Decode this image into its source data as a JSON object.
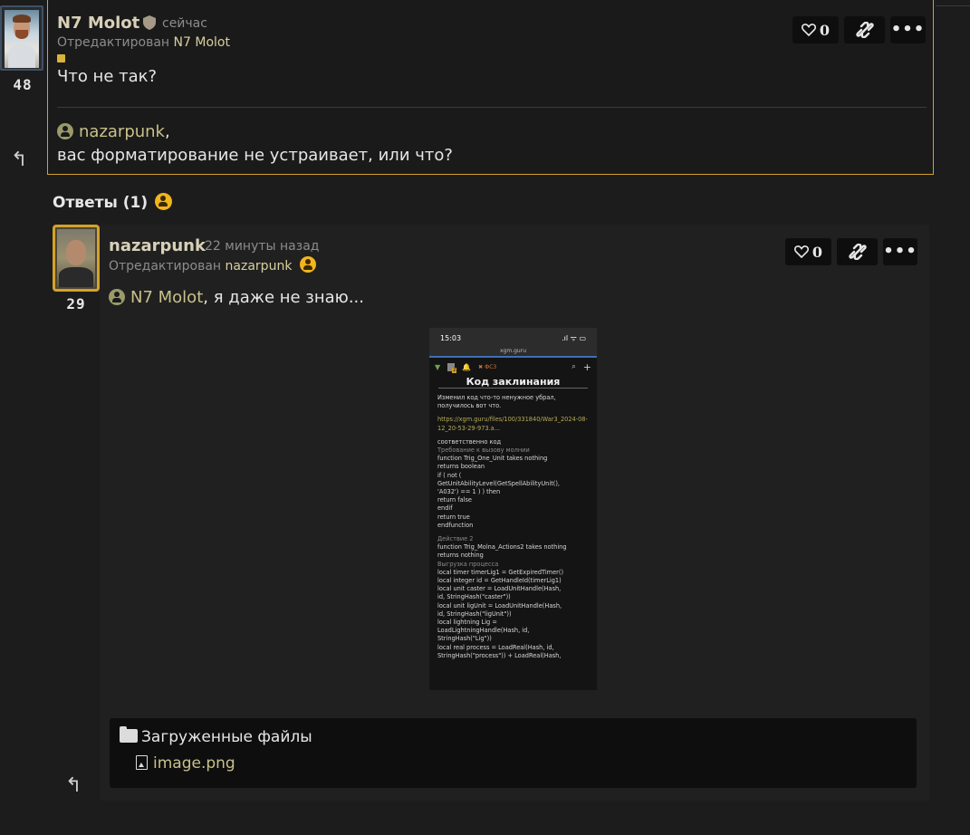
{
  "post1": {
    "author": "N7 Molot",
    "time": "сейчас",
    "edited_label": "Отредактирован",
    "edited_by": "N7 Molot",
    "score": "48",
    "text": "Что не так?",
    "quote_mention": "nazarpunk",
    "quote_suffix": ",",
    "text2": "вас форматирование не устраивает, или что?",
    "likes": "0"
  },
  "answers": {
    "label": "Ответы (1)"
  },
  "post2": {
    "author": "nazarpunk",
    "time": "22 минуты назад",
    "edited_label": "Отредактирован",
    "edited_by": "nazarpunk",
    "score": "29",
    "mention": "N7 Molot",
    "text": ", я даже не знаю...",
    "likes": "0",
    "screenshot": {
      "clock": "15:03",
      "status_icons": ".ıl ᯤ ▭",
      "url": "xgm.guru",
      "nav_label": "ФС3",
      "badge": "2",
      "title": "Код заклинания",
      "intro": "Изменил код что-то ненужное убрал, получилось вот что.",
      "link": "https://xgm.guru/files/100/331840/War3_2024-08-12_20-53-29-973.a...",
      "lines1": [
        "соответственно код"
      ],
      "gray1": "Требование к вызову молнии",
      "code1": [
        "function Trig_One_Unit takes nothing",
        "returns boolean",
        "if ( not (",
        "GetUnitAbilityLevel(GetSpellAbilityUnit(),",
        "'A032') == 1 ) ) then",
        "return false",
        "endif",
        "return true",
        "endfunction"
      ],
      "gray2": "Действие 2",
      "code2": [
        "function Trig_Molna_Actions2 takes nothing",
        "returns nothing"
      ],
      "gray3": "Выгрузка процесса",
      "code3": [
        "local timer timerLig1 = GetExpiredTimer()",
        "local integer id = GetHandleId(timerLig1)",
        "local unit caster = LoadUnitHandle(Hash,",
        "id, StringHash(\"caster\"))",
        "local unit ligUnit = LoadUnitHandle(Hash,",
        "id, StringHash(\"ligUnit\"))",
        "local lightning Lig =",
        "LoadLightningHandle(Hash, id,",
        "StringHash(\"Lig\"))",
        "local real process = LoadReal(Hash, id,",
        "StringHash(\"process\")) + LoadReal(Hash,"
      ]
    }
  },
  "files": {
    "title": "Загруженные файлы",
    "file_name": "image.png"
  },
  "icons": {
    "like": "heart-icon",
    "link": "link-icon",
    "more": "more-icon",
    "reply": "reply-icon",
    "shield": "shield-icon"
  }
}
